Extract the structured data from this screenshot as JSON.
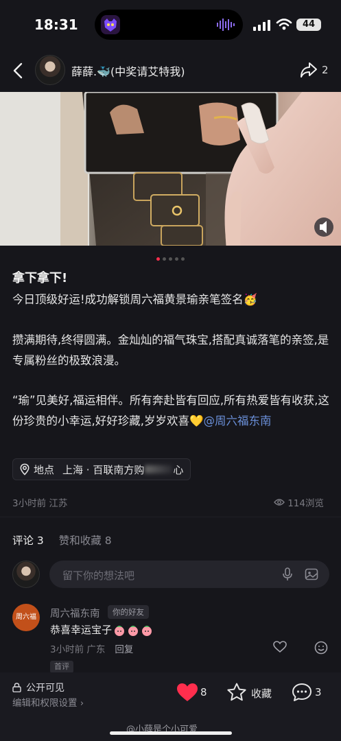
{
  "status": {
    "time": "18:31",
    "battery": "44"
  },
  "header": {
    "username": "薛薛.🐳(中奖请艾特我)",
    "share_count": "2"
  },
  "post": {
    "title": "拿下拿下!",
    "para1": "今日顶级好运!成功解锁周六福黄景瑜亲笔签名🥳",
    "para2": "攒满期待,终得圆满。金灿灿的福气珠宝,搭配真诚落笔的亲签,是专属粉丝的极致浪漫。",
    "para3": "“瑜”见美好,福运相伴。所有奔赴皆有回应,所有热爱皆有收获,这份珍贵的小幸运,好好珍藏,岁岁欢喜💛",
    "mention": "@周六福东南",
    "location_label": "地点",
    "location_a": "上海 · 百联南方购",
    "location_b": "心",
    "time_region": "3小时前 江苏",
    "views": "114浏览"
  },
  "tabs": {
    "comments": "评论 3",
    "likes": "赞和收藏 8"
  },
  "comment_input": {
    "placeholder": "留下你的想法吧"
  },
  "comment": {
    "avatar_text": "周六福",
    "author": "周六福东南",
    "badge": "你的好友",
    "text": "恭喜幸运宝子",
    "time": "3小时前 广东",
    "reply": "回复",
    "first_tag": "首评"
  },
  "bottom": {
    "visibility": "公开可见",
    "settings": "编辑和权限设置 ›",
    "like_count": "8",
    "fav_label": "收藏",
    "comment_count": "3"
  },
  "watermark": "@小薛是个小可爱",
  "colors": {
    "accent": "#ff2e4d",
    "link": "#6a8fd8",
    "background": "#16161b"
  },
  "carousel": {
    "total": 5,
    "active": 1
  }
}
